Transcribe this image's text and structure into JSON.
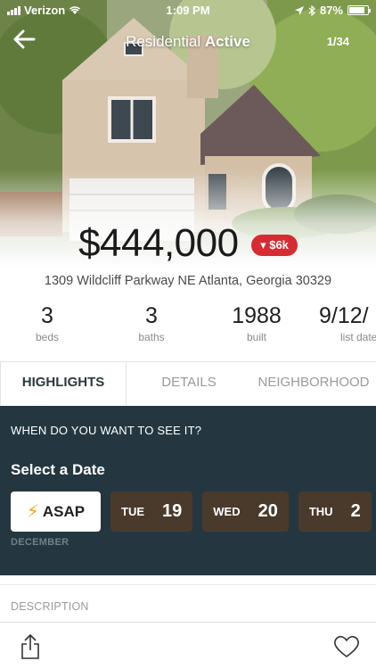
{
  "status_bar": {
    "carrier": "Verizon",
    "time": "1:09 PM",
    "battery": "87%",
    "battery_level": 0.87
  },
  "nav": {
    "title_prefix": "Residential",
    "title_status": "Active",
    "photo_counter": "1/34"
  },
  "listing": {
    "price": "$444,000",
    "price_change": "$6k",
    "address": "1309 Wildcliff Parkway NE Atlanta, Georgia 30329"
  },
  "stats": [
    {
      "value": "3",
      "label": "beds"
    },
    {
      "value": "3",
      "label": "baths"
    },
    {
      "value": "1988",
      "label": "built"
    },
    {
      "value": "9/12/",
      "label": "list date"
    }
  ],
  "tabs": [
    {
      "label": "HIGHLIGHTS",
      "active": true
    },
    {
      "label": "DETAILS",
      "active": false
    },
    {
      "label": "NEIGHBORHOOD",
      "active": false
    }
  ],
  "schedule": {
    "question": "WHEN DO YOU WANT TO SEE IT?",
    "select_label": "Select a Date",
    "asap_label": "ASAP",
    "dates": [
      {
        "dow": "TUE",
        "day": "19"
      },
      {
        "dow": "WED",
        "day": "20"
      },
      {
        "dow": "THU",
        "day": "2"
      }
    ],
    "month": "DECEMBER"
  },
  "description": {
    "heading": "DESCRIPTION"
  },
  "icons": {
    "back": "back-arrow-icon",
    "share": "share-icon",
    "favorite": "heart-icon",
    "asap": "lightning-bolt-icon"
  },
  "colors": {
    "price_drop": "#d62b32",
    "schedule_bg": "#243740",
    "date_chip": "#4a3a2c",
    "bolt": "#f2a51a"
  }
}
